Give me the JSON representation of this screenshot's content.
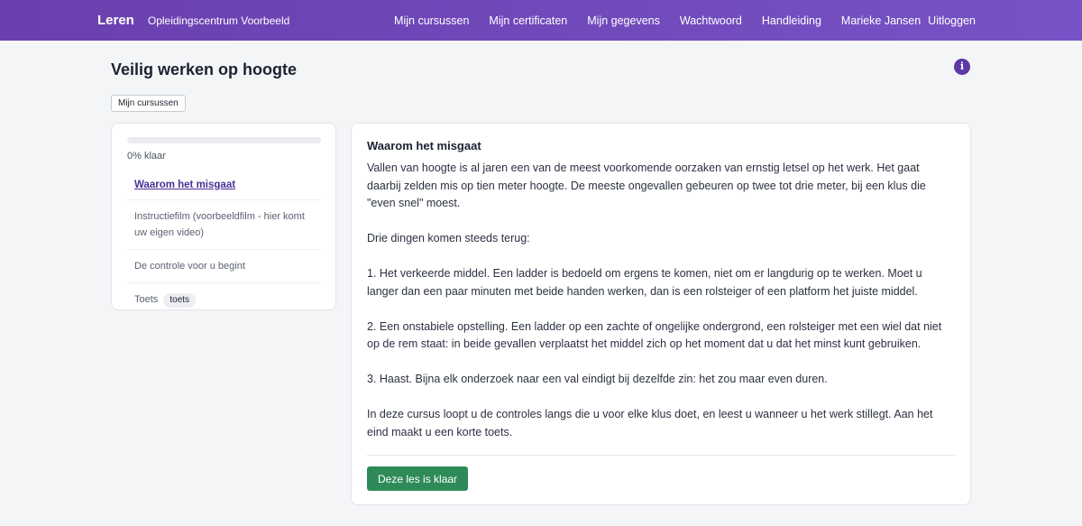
{
  "header": {
    "brand": "Leren",
    "org": "Opleidingscentrum Voorbeeld",
    "nav": [
      "Mijn cursussen",
      "Mijn certificaten",
      "Mijn gegevens",
      "Wachtwoord",
      "Handleiding"
    ],
    "user": "Marieke Jansen",
    "logout": "Uitloggen"
  },
  "page": {
    "title": "Veilig werken op hoogte",
    "info_icon": "i",
    "breadcrumb": "Mijn cursussen"
  },
  "sidebar": {
    "progress_fraction": 0,
    "progress_label": "0% klaar",
    "lessons": [
      {
        "label": "Waarom het misgaat"
      },
      {
        "label": "Instructiefilm (voorbeeldfilm - hier komt uw eigen video)"
      },
      {
        "label": "De controle voor u begint"
      },
      {
        "label": "Toets",
        "tag": "toets"
      }
    ]
  },
  "lesson": {
    "title": "Waarom het misgaat",
    "paragraphs": [
      "Vallen van hoogte is al jaren een van de meest voorkomende oorzaken van ernstig letsel op het werk. Het gaat daarbij zelden mis op tien meter hoogte. De meeste ongevallen gebeuren op twee tot drie meter, bij een klus die \"even snel\" moest.",
      "Drie dingen komen steeds terug:",
      "1. Het verkeerde middel. Een ladder is bedoeld om ergens te komen, niet om er langdurig op te werken. Moet u langer dan een paar minuten met beide handen werken, dan is een rolsteiger of een platform het juiste middel.",
      "2. Een onstabiele opstelling. Een ladder op een zachte of ongelijke ondergrond, een rolsteiger met een wiel dat niet op de rem staat: in beide gevallen verplaatst het middel zich op het moment dat u dat het minst kunt gebruiken.",
      "3. Haast. Bijna elk onderzoek naar een val eindigt bij dezelfde zin: het zou maar even duren.",
      "In deze cursus loopt u de controles langs die u voor elke klus doet, en leest u wanneer u het werk stillegt. Aan het eind maakt u een korte toets."
    ],
    "done_button": "Deze les is klaar"
  },
  "colors": {
    "header_start": "#6a3fae",
    "header_end": "#7653c6",
    "accent": "#5b3aa6",
    "done_button": "#2e8b57"
  }
}
